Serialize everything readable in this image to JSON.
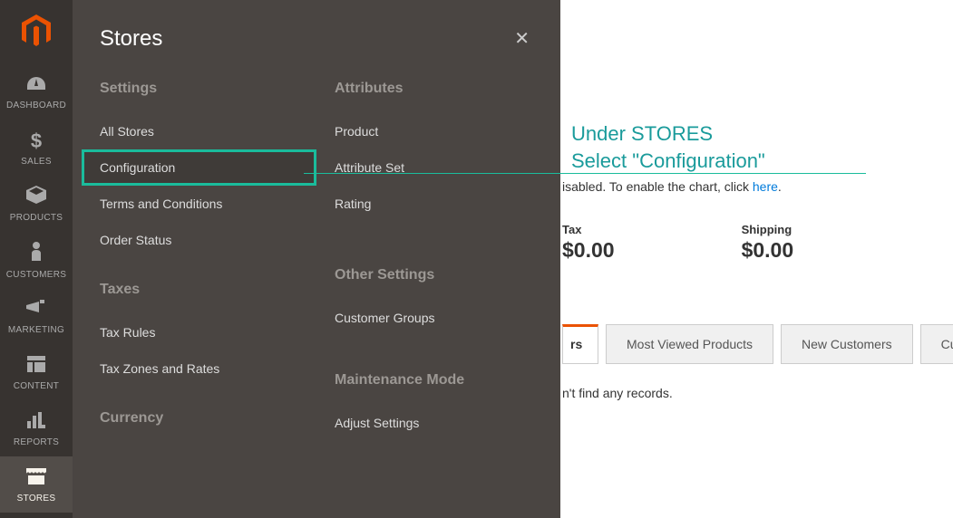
{
  "sidebar": {
    "items": [
      {
        "label": "DASHBOARD"
      },
      {
        "label": "SALES"
      },
      {
        "label": "PRODUCTS"
      },
      {
        "label": "CUSTOMERS"
      },
      {
        "label": "MARKETING"
      },
      {
        "label": "CONTENT"
      },
      {
        "label": "REPORTS"
      },
      {
        "label": "STORES"
      }
    ]
  },
  "flyout": {
    "title": "Stores",
    "col1": {
      "settings_heading": "Settings",
      "all_stores": "All Stores",
      "configuration": "Configuration",
      "terms": "Terms and Conditions",
      "order_status": "Order Status",
      "taxes_heading": "Taxes",
      "tax_rules": "Tax Rules",
      "tax_zones": "Tax Zones and Rates",
      "currency_heading": "Currency"
    },
    "col2": {
      "attributes_heading": "Attributes",
      "product": "Product",
      "attribute_set": "Attribute Set",
      "rating": "Rating",
      "other_heading": "Other Settings",
      "customer_groups": "Customer Groups",
      "maintenance_heading": "Maintenance Mode",
      "adjust_settings": "Adjust Settings"
    }
  },
  "annotation": {
    "line1": "Under STORES",
    "line2": "Select \"Configuration\""
  },
  "chart_msg": {
    "prefix": "isabled. To enable the chart, click ",
    "link": "here",
    "suffix": "."
  },
  "stats": {
    "tax_label": "Tax",
    "tax_value": "$0.00",
    "shipping_label": "Shipping",
    "shipping_value": "$0.00"
  },
  "tabs": {
    "active_partial": "rs",
    "most_viewed": "Most Viewed Products",
    "new_customers": "New Customers",
    "customers_partial": "Custo"
  },
  "empty_msg": "n't find any records."
}
